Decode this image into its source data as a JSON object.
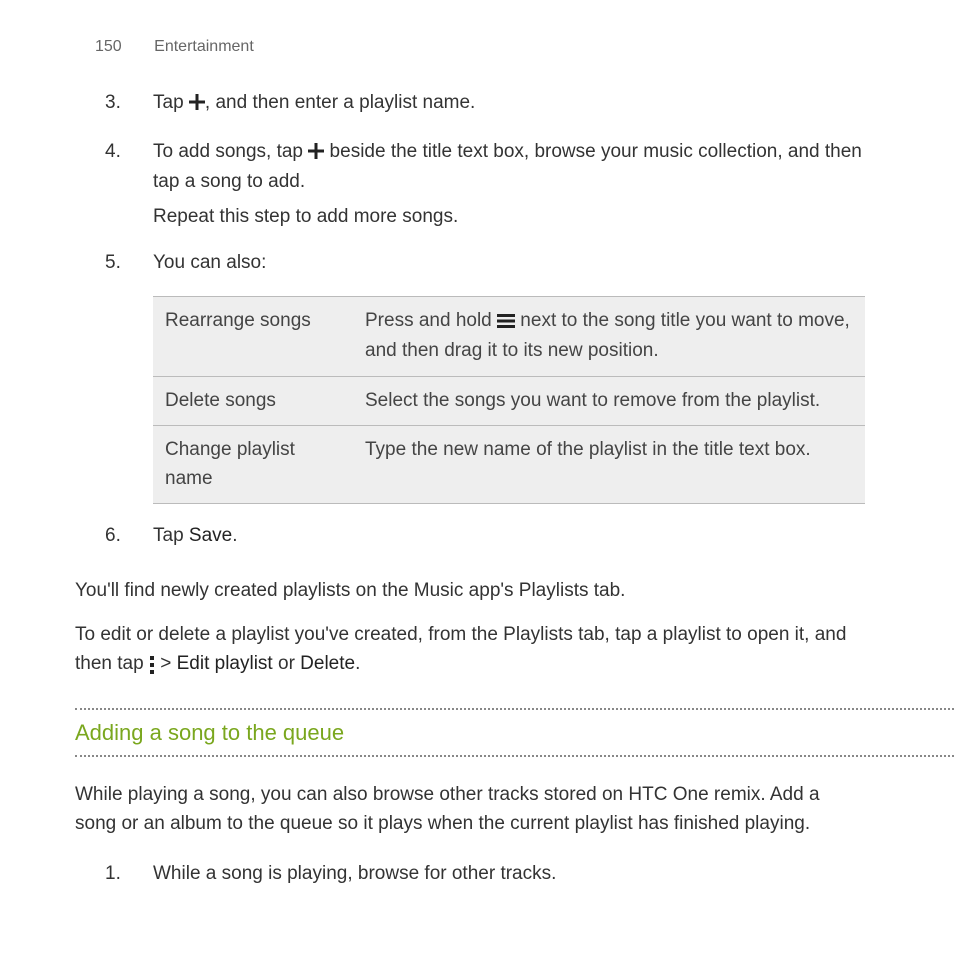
{
  "header": {
    "page": "150",
    "section": "Entertainment"
  },
  "steps": {
    "s3": {
      "num": "3.",
      "a": "Tap ",
      "b": ", and then enter a playlist name."
    },
    "s4": {
      "num": "4.",
      "a": "To add songs, tap ",
      "b": " beside the title text box, browse your music collection, and then tap a song to add.",
      "extra": "Repeat this step to add more songs."
    },
    "s5": {
      "num": "5.",
      "text": "You can also:"
    },
    "s6": {
      "num": "6.",
      "a": "Tap ",
      "save": "Save",
      "b": "."
    }
  },
  "table": {
    "rows": [
      {
        "k": "Rearrange songs",
        "v_a": "Press and hold ",
        "v_b": " next to the song title you want to move, and then drag it to its new position."
      },
      {
        "k": "Delete songs",
        "v": "Select the songs you want to remove from the playlist."
      },
      {
        "k": "Change playlist name",
        "v": "Type the new name of the playlist in the title text box."
      }
    ]
  },
  "after": {
    "p1": "You'll find newly created playlists on the Music app's Playlists tab.",
    "p2_a": "To edit or delete a playlist you've created, from the Playlists tab, tap a playlist to open it, and then tap ",
    "p2_b": " > ",
    "p2_edit": "Edit playlist",
    "p2_c": " or ",
    "p2_delete": "Delete",
    "p2_d": "."
  },
  "section2": {
    "title": "Adding a song to the queue",
    "intro": "While playing a song, you can also browse other tracks stored on HTC One remix. Add a song or an album to the queue so it plays when the current playlist has finished playing.",
    "step1_num": "1.",
    "step1": "While a song is playing, browse for other tracks."
  }
}
